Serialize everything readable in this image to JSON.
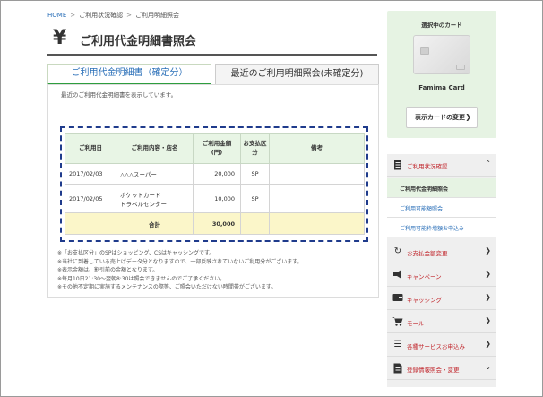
{
  "breadcrumb": {
    "home": "HOME",
    "sep": ">",
    "item1": "ご利用状況確認",
    "item2": "ご利用明細照会"
  },
  "page": {
    "icon": "yen-icon",
    "icon_glyph": "¥",
    "title": "ご利用代金明細書照会"
  },
  "tabs": [
    {
      "label": "ご利用代金明細書（確定分）",
      "active": true
    },
    {
      "label": "最近のご利用明細照会(未確定分)",
      "active": false
    }
  ],
  "intro": "最近のご利用代金明細書を表示しています。",
  "table": {
    "headers": [
      "ご利用日",
      "ご利用内容・店名",
      "ご利用金額(円)",
      "お支払区分",
      "備考"
    ],
    "header_amount_line1": "ご利用金額",
    "header_amount_line2": "(円)",
    "header_pay_line1": "お支払区",
    "header_pay_line2": "分",
    "rows": [
      {
        "date": "2017/02/03",
        "shop_line1": "△△△スーパー",
        "shop_line2": "",
        "amount": "20,000",
        "pay": "SP",
        "note": ""
      },
      {
        "date": "2017/02/05",
        "shop_line1": "ポケットカード",
        "shop_line2": "トラベルセンター",
        "amount": "10,000",
        "pay": "SP",
        "note": ""
      }
    ],
    "total_label": "合計",
    "total_amount": "30,000"
  },
  "notes": [
    "「お支払区分」のSPはショッピング、CSはキャッシングです。",
    "当社に到着している売上げデータ分となりますので、一部反映されていないご利用分がございます。",
    "表示金額は、割引前の金額となります。",
    "毎月10日21:30～翌朝8:30は照会できませんのでご了承ください。",
    "その他不定期に実施するメンテナンスの際等、ご照会いただけない時間帯がございます。"
  ],
  "note_mark": "※",
  "sidebar": {
    "card_label": "選択中のカード",
    "card_name": "Famima Card",
    "card_change_button": "表示カードの変更",
    "menu": [
      {
        "icon": "receipt-icon",
        "label": "ご利用状況確認",
        "expanded": true
      },
      {
        "icon": "refresh-icon",
        "label": "お支払金額変更",
        "expanded": false
      },
      {
        "icon": "megaphone-icon",
        "label": "キャンペーン",
        "expanded": false
      },
      {
        "icon": "wallet-icon",
        "label": "キャッシング",
        "expanded": false
      },
      {
        "icon": "cart-icon",
        "label": "モール",
        "expanded": false
      },
      {
        "icon": "list-icon",
        "label": "各種サービスお申込み",
        "expanded": false
      },
      {
        "icon": "document-icon",
        "label": "登録情報照会・変更",
        "expanded": false
      }
    ],
    "submenu": [
      {
        "label": "ご利用代金明細照会",
        "current": true
      },
      {
        "label": "ご利用可能額照会",
        "current": false
      },
      {
        "label": "ご利用可能枠増額お申込み",
        "current": false
      }
    ]
  },
  "colors": {
    "accent_green": "#2e9e3e",
    "link_blue": "#2a6fb8",
    "menu_red": "#c1272d",
    "highlight_dash": "#1f3b8c",
    "total_row": "#fbf6c9"
  }
}
